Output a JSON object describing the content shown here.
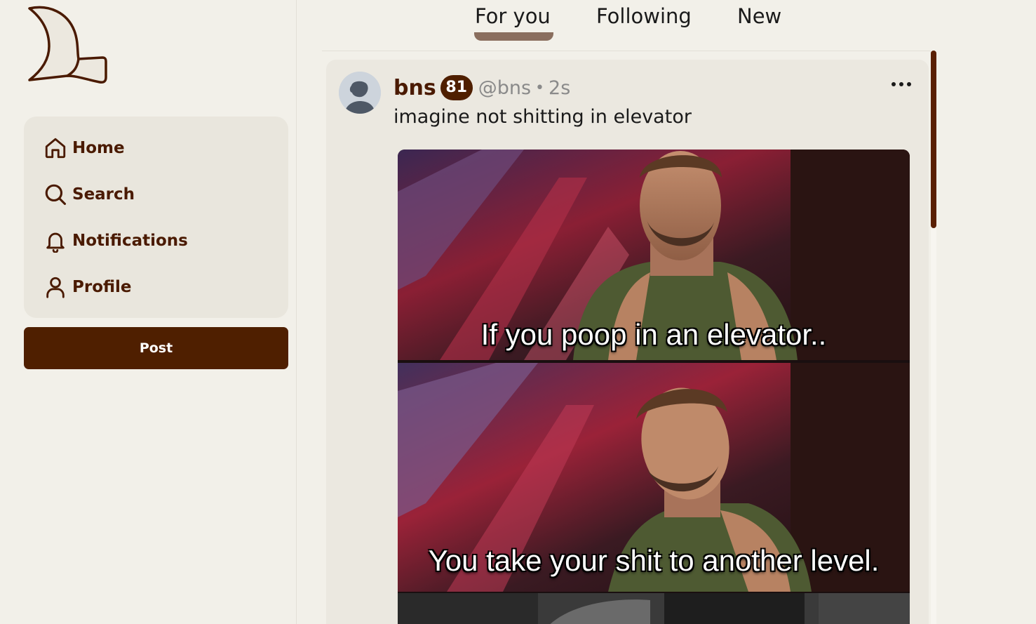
{
  "sidebar": {
    "logo": "hat-logo-icon",
    "items": [
      {
        "label": "Home",
        "icon": "home-icon"
      },
      {
        "label": "Search",
        "icon": "search-icon"
      },
      {
        "label": "Notifications",
        "icon": "bell-icon"
      },
      {
        "label": "Profile",
        "icon": "user-icon"
      }
    ],
    "post_button_label": "Post"
  },
  "tabs": [
    {
      "label": "For you",
      "active": true
    },
    {
      "label": "Following",
      "active": false
    },
    {
      "label": "New",
      "active": false
    }
  ],
  "post": {
    "display_name": "bns",
    "karma": "81",
    "handle": "@bns",
    "separator": "•",
    "time": "2s",
    "text": "imagine not shitting in elevator",
    "menu_icon": "more-horizontal-icon",
    "image": {
      "captions": [
        "If you poop in an elevator..",
        "You take your shit to another level."
      ]
    }
  },
  "colors": {
    "background": "#f2f0e9",
    "card": "#ebe8e0",
    "accent": "#4f1f00",
    "tab_indicator": "#8a6e5e",
    "muted_text": "#8a8a8a"
  }
}
